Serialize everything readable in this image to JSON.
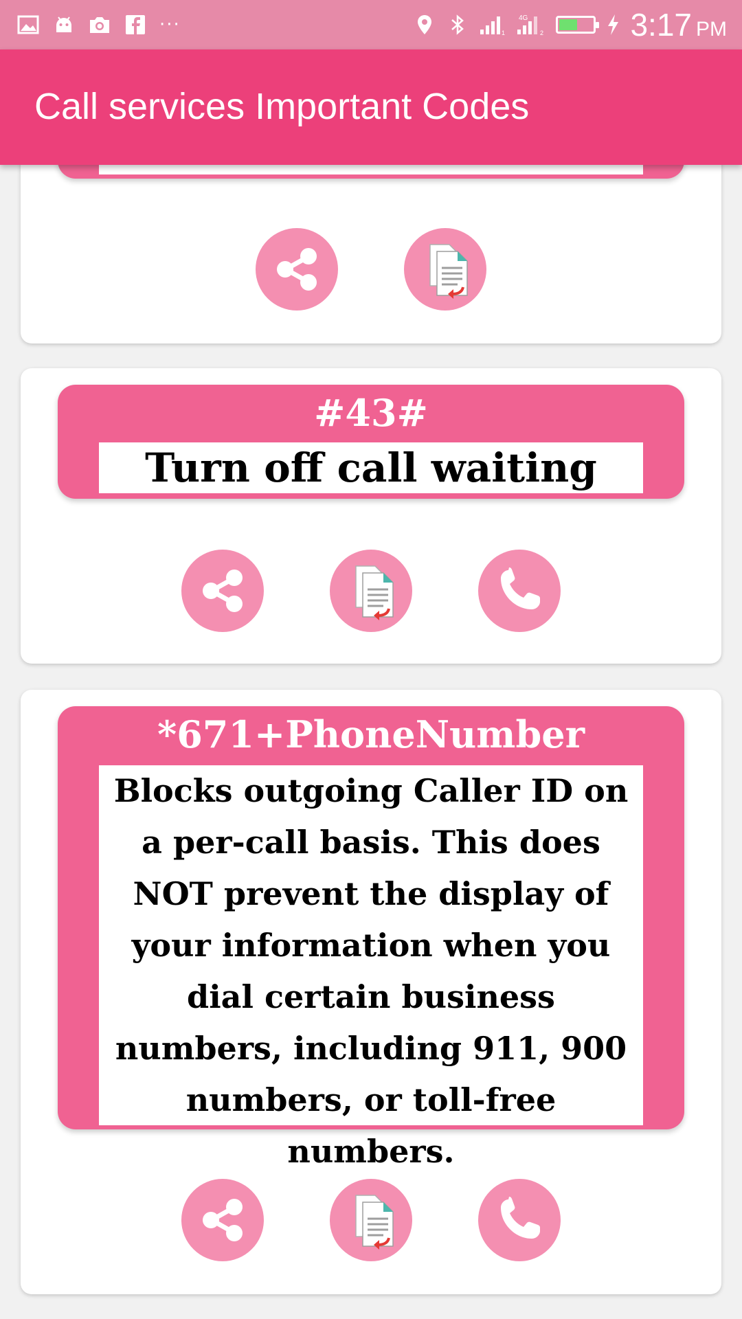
{
  "status_bar": {
    "time": "3:17",
    "ampm": "PM",
    "more": "···",
    "network_label": "4G",
    "battery_level": 0.55,
    "icons": [
      "image-icon",
      "android-icon",
      "camera-icon",
      "facebook-icon",
      "location-icon",
      "bluetooth-icon",
      "signal-icon",
      "signal-4g-icon",
      "battery-icon",
      "charging-icon"
    ]
  },
  "app_bar": {
    "title": "Call services Important Codes"
  },
  "colors": {
    "app_bar": "#ec407a",
    "status_bar": "#e68aa8",
    "code_box": "#f06292",
    "button": "#f48fb1"
  },
  "cards": [
    {
      "code": "",
      "description": "",
      "actions": [
        "share-icon",
        "copy-icon"
      ]
    },
    {
      "code": "#43#",
      "description": "Turn off call waiting",
      "actions": [
        "share-icon",
        "copy-icon",
        "phone-icon"
      ]
    },
    {
      "code": "*671+PhoneNumber",
      "description": "Blocks outgoing Caller ID on a per-call basis. This does NOT prevent the display of your information when you dial certain business numbers, including 911, 900 numbers, or toll-free numbers.",
      "actions": [
        "share-icon",
        "copy-icon",
        "phone-icon"
      ]
    }
  ]
}
